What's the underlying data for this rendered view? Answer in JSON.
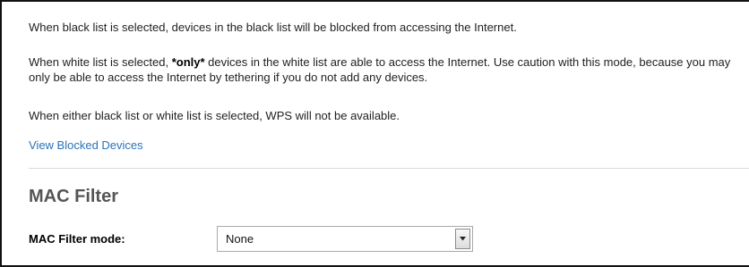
{
  "info": {
    "black_list_text": "When black list is selected, devices in the black list will be blocked from accessing the Internet.",
    "white_list_prefix": "When white list is selected, ",
    "white_list_emphasis": "*only*",
    "white_list_suffix": " devices in the white list are able to access the Internet. Use caution with this mode, because you may only be able to access the Internet by tethering if you do not add any devices.",
    "wps_text": "When either black list or white list is selected, WPS will not be available."
  },
  "links": {
    "view_blocked_devices": "View Blocked Devices"
  },
  "mac_filter": {
    "title": "MAC Filter",
    "mode_label": "MAC Filter mode:",
    "mode_value": "None"
  },
  "icons": {
    "dropdown": "chevron-down-icon"
  },
  "colors": {
    "link": "#2a74b8",
    "section_title": "#555555",
    "divider": "#d9d9d9"
  }
}
